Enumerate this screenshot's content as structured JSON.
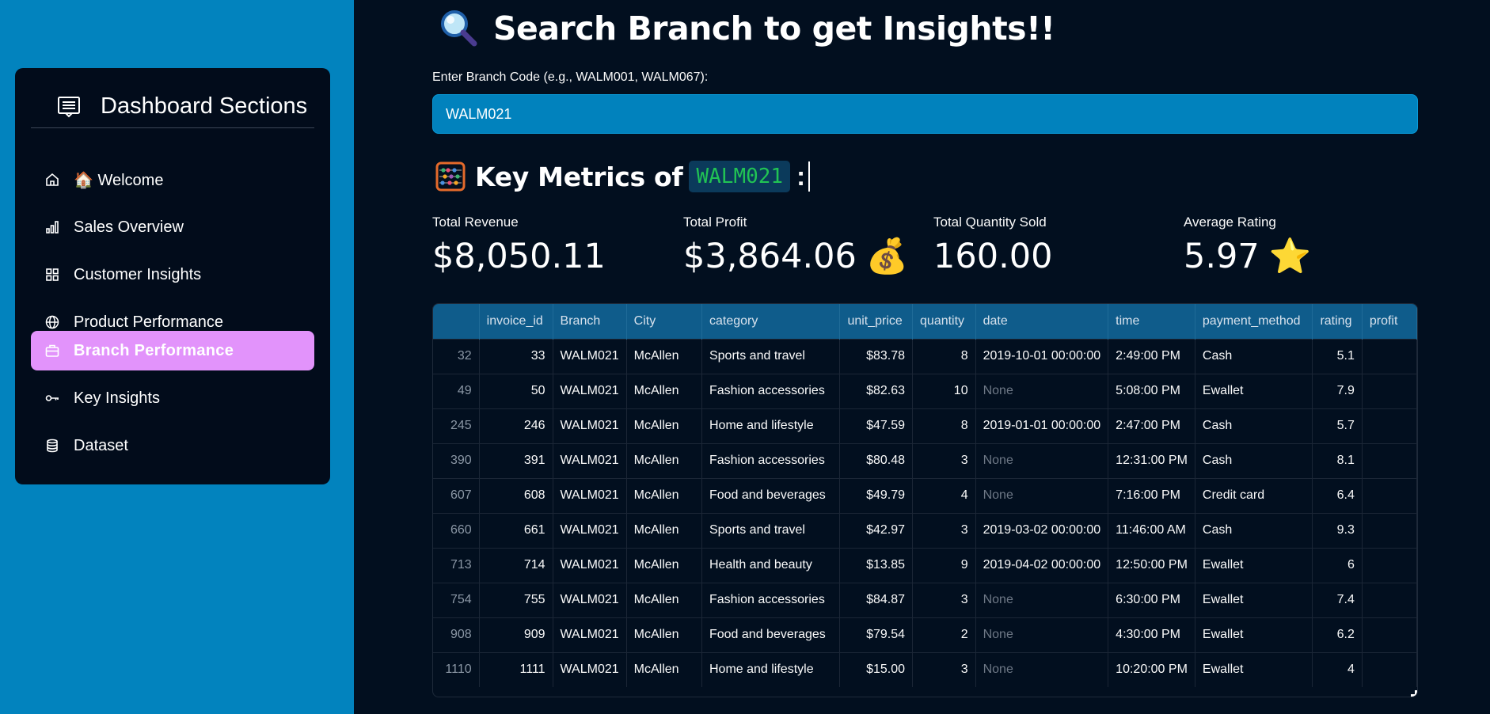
{
  "sidebar": {
    "title": "Dashboard Sections",
    "items": [
      {
        "label": "🏠 Welcome",
        "icon": "house-icon",
        "active": false
      },
      {
        "label": "Sales Overview",
        "icon": "bar-chart-icon",
        "active": false
      },
      {
        "label": "Customer Insights",
        "icon": "grid-icon",
        "active": false
      },
      {
        "label": "Product Performance",
        "icon": "globe-icon",
        "active": false
      },
      {
        "label": "Branch Performance",
        "icon": "briefcase-icon",
        "active": true
      },
      {
        "label": "Key Insights",
        "icon": "key-icon",
        "active": false
      },
      {
        "label": "Dataset",
        "icon": "database-icon",
        "active": false
      }
    ],
    "active_color": "#e293fb"
  },
  "main": {
    "title": "Search Branch to get Insights!!",
    "search_label": "Enter Branch Code (e.g., WALM001, WALM067):",
    "search_value": "WALM021",
    "metrics_heading": "Key Metrics of",
    "metrics_code": "WALM021",
    "metrics_colon": ":",
    "metrics": [
      {
        "label": "Total Revenue",
        "value": "$8,050.11",
        "emoji": ""
      },
      {
        "label": "Total Profit",
        "value": "$3,864.06",
        "emoji": "💰"
      },
      {
        "label": "Total Quantity Sold",
        "value": "160.00",
        "emoji": ""
      },
      {
        "label": "Average Rating",
        "value": "5.97",
        "emoji": "⭐"
      }
    ]
  },
  "table": {
    "columns": [
      "",
      "invoice_id",
      "Branch",
      "City",
      "category",
      "unit_price",
      "quantity",
      "date",
      "time",
      "payment_method",
      "rating",
      "profit"
    ],
    "rows": [
      [
        "32",
        "33",
        "WALM021",
        "McAllen",
        "Sports and travel",
        "$83.78",
        "8",
        "2019-10-01 00:00:00",
        "2:49:00 PM",
        "Cash",
        "5.1",
        ""
      ],
      [
        "49",
        "50",
        "WALM021",
        "McAllen",
        "Fashion accessories",
        "$82.63",
        "10",
        "None",
        "5:08:00 PM",
        "Ewallet",
        "7.9",
        ""
      ],
      [
        "245",
        "246",
        "WALM021",
        "McAllen",
        "Home and lifestyle",
        "$47.59",
        "8",
        "2019-01-01 00:00:00",
        "2:47:00 PM",
        "Cash",
        "5.7",
        ""
      ],
      [
        "390",
        "391",
        "WALM021",
        "McAllen",
        "Fashion accessories",
        "$80.48",
        "3",
        "None",
        "12:31:00 PM",
        "Cash",
        "8.1",
        ""
      ],
      [
        "607",
        "608",
        "WALM021",
        "McAllen",
        "Food and beverages",
        "$49.79",
        "4",
        "None",
        "7:16:00 PM",
        "Credit card",
        "6.4",
        ""
      ],
      [
        "660",
        "661",
        "WALM021",
        "McAllen",
        "Sports and travel",
        "$42.97",
        "3",
        "2019-03-02 00:00:00",
        "11:46:00 AM",
        "Cash",
        "9.3",
        ""
      ],
      [
        "713",
        "714",
        "WALM021",
        "McAllen",
        "Health and beauty",
        "$13.85",
        "9",
        "2019-04-02 00:00:00",
        "12:50:00 PM",
        "Ewallet",
        "6",
        ""
      ],
      [
        "754",
        "755",
        "WALM021",
        "McAllen",
        "Fashion accessories",
        "$84.87",
        "3",
        "None",
        "6:30:00 PM",
        "Ewallet",
        "7.4",
        ""
      ],
      [
        "908",
        "909",
        "WALM021",
        "McAllen",
        "Food and beverages",
        "$79.54",
        "2",
        "None",
        "4:30:00 PM",
        "Ewallet",
        "6.2",
        ""
      ],
      [
        "1110",
        "1111",
        "WALM021",
        "McAllen",
        "Home and lifestyle",
        "$15.00",
        "3",
        "None",
        "10:20:00 PM",
        "Ewallet",
        "4",
        ""
      ]
    ]
  }
}
